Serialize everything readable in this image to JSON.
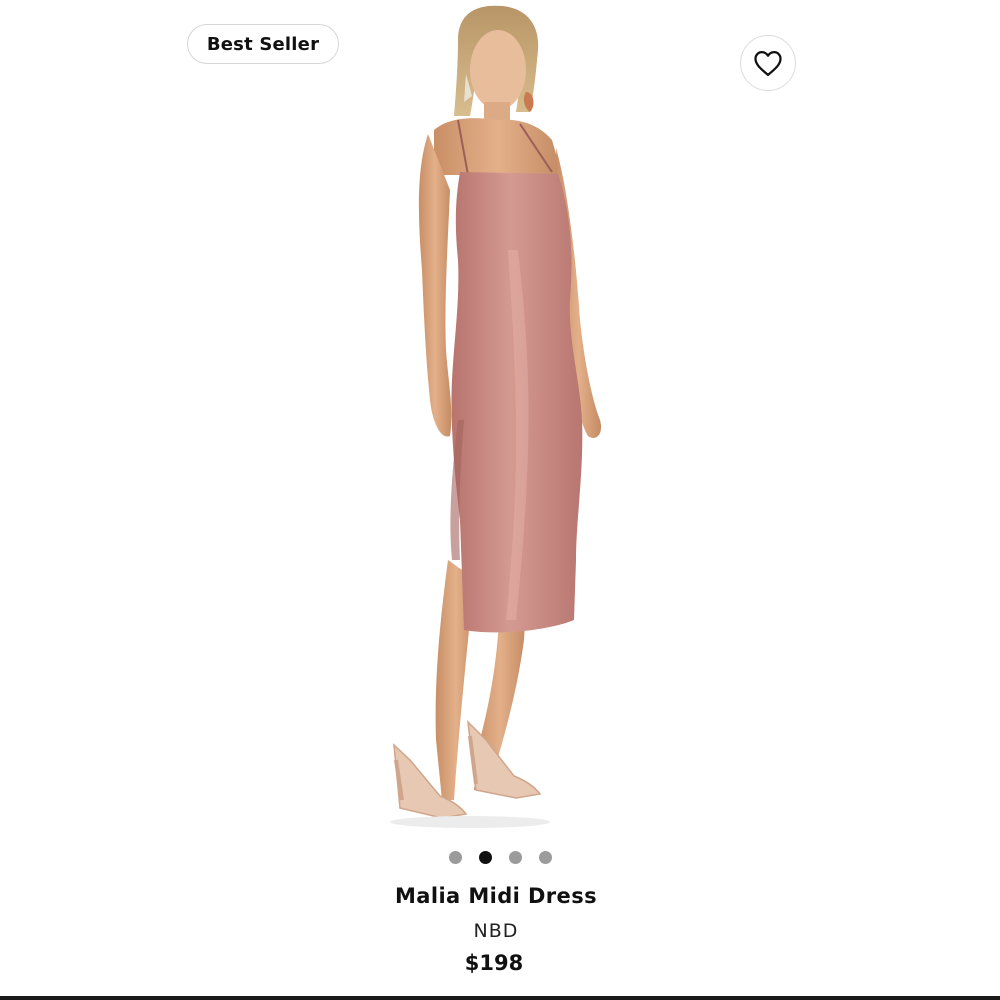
{
  "badge": {
    "label": "Best Seller"
  },
  "wishlist": {
    "icon": "heart-icon"
  },
  "product_image": {
    "subject": "model wearing pink satin midi slip dress",
    "dress_color": "#c98a83"
  },
  "carousel": {
    "dots": [
      {
        "active": false
      },
      {
        "active": true
      },
      {
        "active": false
      },
      {
        "active": false
      }
    ],
    "active_index": 1,
    "total": 4
  },
  "product": {
    "name": "Malia Midi Dress",
    "brand": "NBD",
    "price": "$198"
  },
  "colors": {
    "dot_active": "#111111",
    "dot_inactive": "#9b9b9b",
    "badge_border": "#d6d6d6"
  }
}
